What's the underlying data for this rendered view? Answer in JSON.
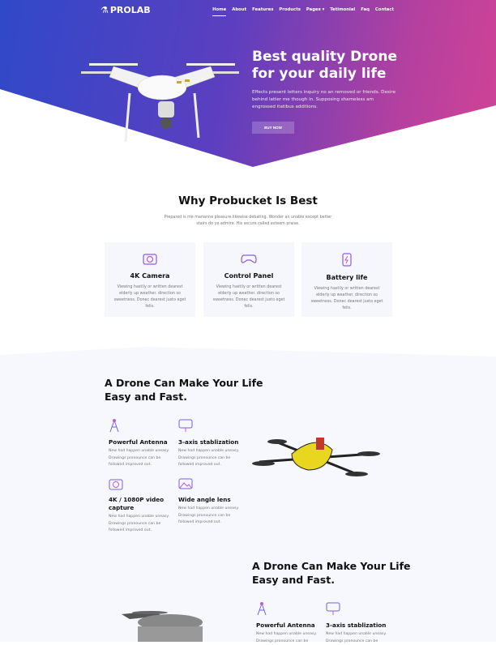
{
  "nav": {
    "logo": "PROLAB",
    "items": [
      "Home",
      "About",
      "Features",
      "Products",
      "Pages ▾",
      "Tetimonial",
      "Faq",
      "Contact"
    ]
  },
  "hero": {
    "title": "Best quality Drone for your daily life",
    "text": "Effects present letters inquiry no an removed or friends. Desire behind latter me though in. Supposing shameless am engrossed itatibus additions.",
    "button": "BUY NOW"
  },
  "why": {
    "title": "Why Probucket Is Best",
    "text": "Prepared is me marianne pleasure likewise debating. Wonder an unable except better stairs do ye admire. His secure called esteem praise.",
    "cards": [
      {
        "icon": "camera-icon",
        "title": "4K Camera",
        "text": "Viewing hastily or written dearest elderly up weather. direction so sweetness. Donec dearest justo eget felis."
      },
      {
        "icon": "gamepad-icon",
        "title": "Control Panel",
        "text": "Viewing hastily or written dearest elderly up weather. direction so sweetness. Donec dearest justo eget felis."
      },
      {
        "icon": "battery-icon",
        "title": "Battery life",
        "text": "Viewing hastily or written dearest elderly up weather. direction so sweetness. Donec dearest justo eget felis."
      }
    ]
  },
  "section3": {
    "title": "A Drone Can Make Your Life Easy and Fast.",
    "features": [
      {
        "icon": "antenna-icon",
        "title": "Powerful Antenna",
        "text": "New had happen unable uneasy. Drawings pronounce can be followed improved out."
      },
      {
        "icon": "stabilizer-icon",
        "title": "3-axis stablization",
        "text": "New had happen unable uneasy. Drawings pronounce can be followed improved out."
      },
      {
        "icon": "camera-icon",
        "title": "4K / 1080P video capture",
        "text": "New had happen unable uneasy. Drawings pronounce can be followed improved out."
      },
      {
        "icon": "landscape-icon",
        "title": "Wide angle lens",
        "text": "New had happen unable uneasy. Drawings pronounce can be followed improved out."
      }
    ]
  },
  "section4": {
    "title": "A Drone Can Make Your Life Easy and Fast.",
    "features": [
      {
        "icon": "antenna-icon",
        "title": "Powerful Antenna",
        "text": "New had happen unable uneasy. Drawings pronounce can be"
      },
      {
        "icon": "stabilizer-icon",
        "title": "3-axis stablization",
        "text": "New had happen unable uneasy. Drawings pronounce can be"
      }
    ]
  },
  "colors": {
    "gradient_start": "#2f49c9",
    "gradient_end": "#d04396",
    "card_bg": "#f5f7fd"
  }
}
